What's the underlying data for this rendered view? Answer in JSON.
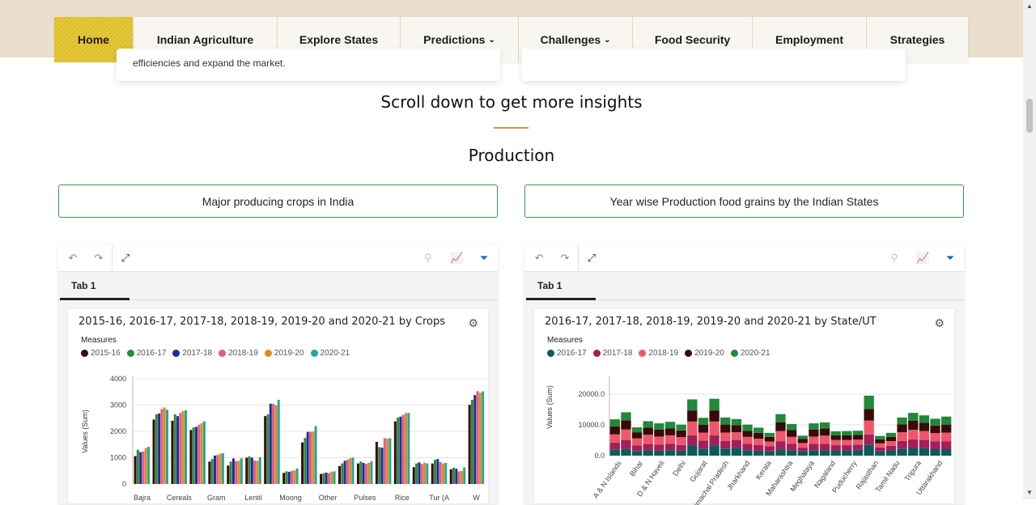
{
  "nav": {
    "items": [
      {
        "label": "Home",
        "chevron": false
      },
      {
        "label": "Indian Agriculture",
        "chevron": false
      },
      {
        "label": "Explore States",
        "chevron": false
      },
      {
        "label": "Predictions",
        "chevron": true
      },
      {
        "label": "Challenges",
        "chevron": true
      },
      {
        "label": "Food Security",
        "chevron": false
      },
      {
        "label": "Employment",
        "chevron": false
      },
      {
        "label": "Strategies",
        "chevron": false
      }
    ],
    "active_color": "#e3c32c"
  },
  "cards_top": {
    "left_text": "efficiencies and expand the market."
  },
  "intro": {
    "scroll_title": "Scroll down to get more insights",
    "section_title": "Production"
  },
  "boxes": {
    "left": "Major producing crops in India",
    "right": "Year wise Production food grains by the Indian States"
  },
  "panels": {
    "left": {
      "tab": "Tab 1",
      "title": "2015-16, 2016-17, 2017-18, 2018-19, 2019-20 and 2020-21 by Crops",
      "measures": "Measures"
    },
    "right": {
      "tab": "Tab 1",
      "title": "2016-17, 2017-18, 2018-19, 2019-20 and 2020-21 by State/UT",
      "measures": "Measures"
    }
  },
  "chart_data": [
    {
      "type": "bar",
      "title": "2015-16, 2016-17, 2017-18, 2018-19, 2019-20 and 2020-21 by Crops",
      "ylabel": "Values (Sum)",
      "ylim": [
        0,
        4000
      ],
      "yticks": [
        0,
        1000,
        2000,
        3000,
        4000
      ],
      "categories": [
        "Bajra",
        "",
        "Cereals",
        "",
        "Gram",
        "",
        "Lentil",
        "",
        "Moong",
        "",
        "Other",
        "",
        "Pulses",
        "",
        "Rice",
        "",
        "Tur (A",
        "",
        "W"
      ],
      "series": [
        {
          "name": "2015-16",
          "color": "#3b0a0a",
          "values": [
            1060,
            2450,
            2400,
            2050,
            850,
            700,
            1000,
            2580,
            420,
            1580,
            380,
            680,
            780,
            1600,
            2380,
            640,
            780,
            560,
            3010
          ]
        },
        {
          "name": "2016-17",
          "color": "#2e8b3a",
          "values": [
            1300,
            2650,
            2650,
            2150,
            950,
            850,
            1050,
            2650,
            480,
            1750,
            410,
            780,
            850,
            1400,
            2520,
            780,
            920,
            620,
            3200
          ]
        },
        {
          "name": "2017-18",
          "color": "#1a2f9a",
          "values": [
            1210,
            2680,
            2580,
            2170,
            1080,
            970,
            1000,
            3050,
            460,
            1980,
            430,
            880,
            800,
            1380,
            2560,
            820,
            950,
            580,
            3380
          ]
        },
        {
          "name": "2018-19",
          "color": "#e05a8a",
          "values": [
            1230,
            2850,
            2700,
            2250,
            1100,
            870,
            890,
            3050,
            500,
            1980,
            410,
            920,
            760,
            1740,
            2630,
            760,
            830,
            480,
            3530
          ]
        },
        {
          "name": "2019-20",
          "color": "#e08a1c",
          "values": [
            1370,
            2910,
            2770,
            2310,
            1150,
            880,
            880,
            2990,
            520,
            1990,
            470,
            980,
            800,
            1720,
            2700,
            810,
            780,
            500,
            3470
          ]
        },
        {
          "name": "2020-21",
          "color": "#20a89a",
          "values": [
            1410,
            2820,
            2800,
            2380,
            1170,
            980,
            1020,
            3200,
            590,
            2200,
            480,
            1000,
            860,
            1740,
            2700,
            780,
            800,
            630,
            3520
          ]
        }
      ]
    },
    {
      "type": "bar",
      "stacked": true,
      "title": "2016-17, 2017-18, 2018-19, 2019-20 and 2020-21 by State/UT",
      "ylabel": "Values (Sum)",
      "ylim": [
        0,
        25000
      ],
      "yticks": [
        0,
        10000,
        20000
      ],
      "ytick_labels": [
        "0.0",
        "10000.0",
        "20000.0"
      ],
      "x_labels": [
        "A & N Islands",
        "Bihar",
        "D & N Haveli",
        "Delhi",
        "Gujarat",
        "Himachal Pradesh",
        "Jharkhand",
        "Kerala",
        "Maharashtra",
        "Meghalaya",
        "Nagaland",
        "Puducherry",
        "Rajasthan",
        "Tamil Nadu",
        "Tripura",
        "Uttarakhand"
      ],
      "series": [
        {
          "name": "2016-17",
          "color": "#0e5a5a",
          "values": [
            1900,
            2200,
            1500,
            1800,
            1600,
            1800,
            1600,
            3400,
            2300,
            3400,
            2300,
            2600,
            1800,
            1600,
            1400,
            2000,
            1800,
            1400,
            1800,
            1700,
            1700,
            1700,
            1900,
            3600,
            1400,
            1700,
            2300,
            2500,
            2400,
            2100,
            2100
          ]
        },
        {
          "name": "2017-18",
          "color": "#a31f5a",
          "values": [
            2300,
            2800,
            1800,
            2000,
            2000,
            2100,
            1900,
            3200,
            2600,
            3200,
            2500,
            2500,
            2100,
            1900,
            1700,
            2700,
            2100,
            1200,
            2000,
            2100,
            1700,
            1700,
            1700,
            3300,
            1300,
            1500,
            2500,
            2800,
            2700,
            2600,
            2600
          ]
        },
        {
          "name": "2018-19",
          "color": "#f0566a",
          "values": [
            2700,
            3500,
            2300,
            3000,
            2600,
            2700,
            2500,
            4500,
            2600,
            4500,
            2700,
            2500,
            2200,
            2000,
            1500,
            3300,
            2200,
            1500,
            2400,
            2700,
            1700,
            1700,
            1600,
            4500,
            1300,
            1500,
            2800,
            3100,
            2900,
            2600,
            2800
          ]
        },
        {
          "name": "2019-20",
          "color": "#3a0a0a",
          "values": [
            2600,
            3000,
            2000,
            2300,
            2300,
            2300,
            2200,
            3600,
            2500,
            3600,
            2600,
            2300,
            2000,
            1900,
            1500,
            2800,
            2200,
            1300,
            2300,
            2300,
            1500,
            1500,
            1500,
            3800,
            1300,
            1400,
            2600,
            3000,
            2700,
            2500,
            2600
          ]
        },
        {
          "name": "2020-21",
          "color": "#22883a",
          "values": [
            2300,
            2600,
            1600,
            2100,
            2000,
            2100,
            1900,
            3600,
            2300,
            3800,
            2300,
            2000,
            2000,
            1700,
            1300,
            2700,
            2000,
            1100,
            2000,
            2000,
            1300,
            1400,
            1400,
            4300,
            1100,
            1300,
            2200,
            2500,
            2400,
            2200,
            2600
          ]
        }
      ]
    }
  ]
}
